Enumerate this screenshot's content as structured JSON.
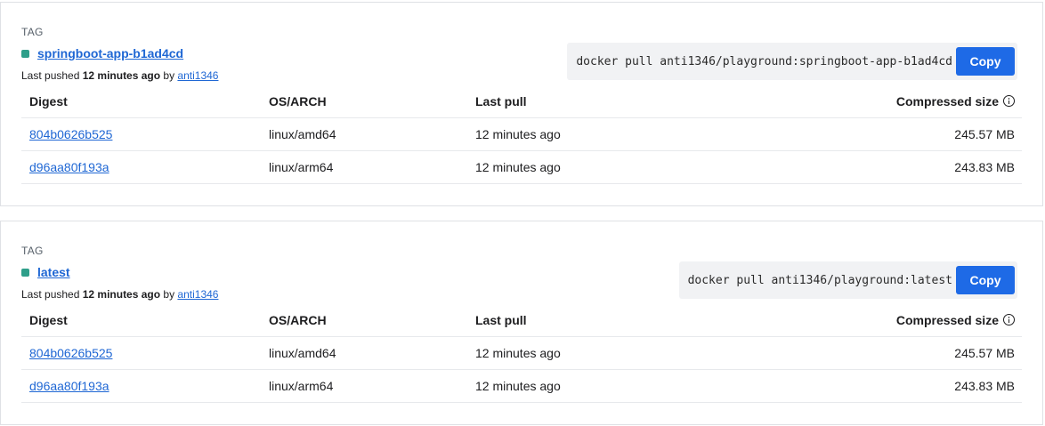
{
  "tags": [
    {
      "caption": "TAG",
      "name": "springboot-app-b1ad4cd",
      "pushed_prefix": "Last pushed ",
      "pushed_time": "12 minutes ago",
      "pushed_by": " by ",
      "user": "anti1346",
      "pull_command": "docker pull anti1346/playground:springboot-app-b1ad4cd",
      "copy_label": "Copy",
      "headers": {
        "digest": "Digest",
        "os_arch": "OS/ARCH",
        "last_pull": "Last pull",
        "size": "Compressed size"
      },
      "rows": [
        {
          "digest": "804b0626b525",
          "os_arch": "linux/amd64",
          "last_pull": "12 minutes ago",
          "size": "245.57 MB"
        },
        {
          "digest": "d96aa80f193a",
          "os_arch": "linux/arm64",
          "last_pull": "12 minutes ago",
          "size": "243.83 MB"
        }
      ]
    },
    {
      "caption": "TAG",
      "name": "latest",
      "pushed_prefix": "Last pushed ",
      "pushed_time": "12 minutes ago",
      "pushed_by": " by ",
      "user": "anti1346",
      "pull_command": "docker pull anti1346/playground:latest",
      "copy_label": "Copy",
      "headers": {
        "digest": "Digest",
        "os_arch": "OS/ARCH",
        "last_pull": "Last pull",
        "size": "Compressed size"
      },
      "rows": [
        {
          "digest": "804b0626b525",
          "os_arch": "linux/amd64",
          "last_pull": "12 minutes ago",
          "size": "245.57 MB"
        },
        {
          "digest": "d96aa80f193a",
          "os_arch": "linux/arm64",
          "last_pull": "12 minutes ago",
          "size": "243.83 MB"
        }
      ]
    }
  ],
  "colors": {
    "accent": "#1e6ae6",
    "link": "#1f67d4",
    "tag_dot": "#2e9f8a"
  },
  "icons": {
    "status": "status-dot-icon",
    "info": "info-icon"
  }
}
